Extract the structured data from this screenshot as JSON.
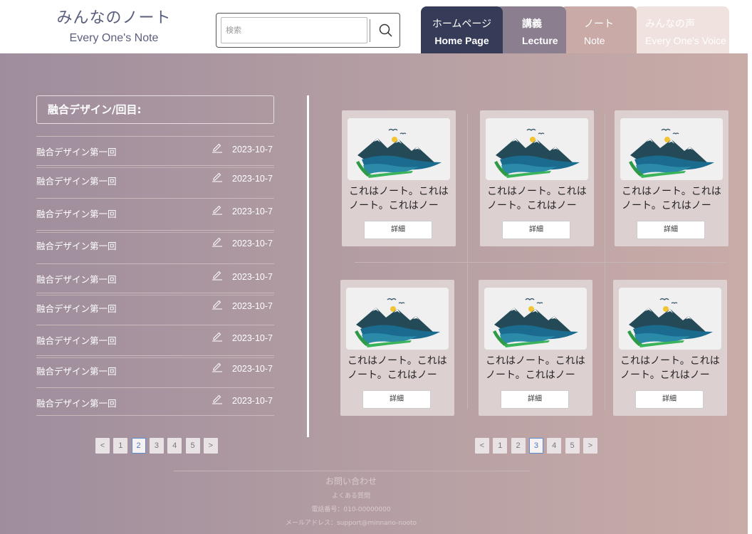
{
  "logo": {
    "title_jp": "みんなのノート",
    "title_en": "Every One's Note"
  },
  "search": {
    "placeholder": "検索",
    "icon": "search-icon"
  },
  "nav": {
    "tabs": [
      {
        "jp": "ホームページ",
        "en": "Home Page"
      },
      {
        "jp": "講義",
        "en": "Lecture"
      },
      {
        "jp": "ノート",
        "en": "Note"
      },
      {
        "jp": "みんなの声",
        "en": "Every One's Voice"
      }
    ]
  },
  "sidebar": {
    "title": "融合デザイン/回目:",
    "items": [
      {
        "label": "融合デザイン第一回",
        "date": "2023-10-7"
      },
      {
        "label": "融合デザイン第一回",
        "date": "2023-10-7"
      },
      {
        "label": "融合デザイン第一回",
        "date": "2023-10-7"
      },
      {
        "label": "融合デザイン第一回",
        "date": "2023-10-7"
      },
      {
        "label": "融合デザイン第一回",
        "date": "2023-10-7"
      },
      {
        "label": "融合デザイン第一回",
        "date": "2023-10-7"
      },
      {
        "label": "融合デザイン第一回",
        "date": "2023-10-7"
      },
      {
        "label": "融合デザイン第一回",
        "date": "2023-10-7"
      },
      {
        "label": "融合デザイン第一回",
        "date": "2023-10-7"
      }
    ],
    "pager": {
      "prev": "<",
      "pages": [
        "1",
        "2",
        "3",
        "4",
        "5"
      ],
      "next": ">",
      "active": "2"
    }
  },
  "cards": {
    "items": [
      {
        "text": "これはノート。これはノート。これはノー",
        "button": "詳細"
      },
      {
        "text": "これはノート。これはノート。これはノー",
        "button": "詳細"
      },
      {
        "text": "これはノート。これはノート。これはノー",
        "button": "詳細"
      },
      {
        "text": "これはノート。これはノート。これはノー",
        "button": "詳細"
      },
      {
        "text": "これはノート。これはノート。これはノー",
        "button": "詳細"
      },
      {
        "text": "これはノート。これはノート。これはノー",
        "button": "詳細"
      }
    ],
    "pager": {
      "prev": "<",
      "pages": [
        "1",
        "2",
        "3",
        "4",
        "5"
      ],
      "next": ">",
      "active": "3"
    }
  },
  "footer": {
    "contact": "お問い合わせ",
    "faq": "よくある質問",
    "phone": "電話番号：010-00000000",
    "email": "メールアドレス：support@minnano-nooto"
  },
  "colors": {
    "nav_home": "#363b58",
    "nav_lecture": "#8a7e8f",
    "nav_note": "#c9aaa7",
    "nav_voice": "#f0e2de",
    "accent": "#5b8ed0"
  }
}
